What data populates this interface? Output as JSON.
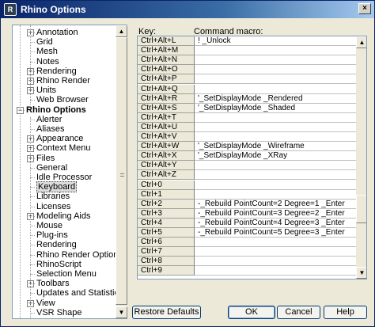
{
  "window": {
    "title": "Rhino Options"
  },
  "tree": {
    "items": [
      {
        "label": "Annotation",
        "level": 2,
        "expander": "+"
      },
      {
        "label": "Grid",
        "level": 2
      },
      {
        "label": "Mesh",
        "level": 2
      },
      {
        "label": "Notes",
        "level": 2
      },
      {
        "label": "Rendering",
        "level": 2,
        "expander": "+"
      },
      {
        "label": "Rhino Render",
        "level": 2,
        "expander": "+"
      },
      {
        "label": "Units",
        "level": 2,
        "expander": "+"
      },
      {
        "label": "Web Browser",
        "level": 2
      },
      {
        "label": "Rhino Options",
        "level": 1,
        "expander": "−",
        "bold": true
      },
      {
        "label": "Alerter",
        "level": 2
      },
      {
        "label": "Aliases",
        "level": 2
      },
      {
        "label": "Appearance",
        "level": 2,
        "expander": "+"
      },
      {
        "label": "Context Menu",
        "level": 2,
        "expander": "+"
      },
      {
        "label": "Files",
        "level": 2,
        "expander": "+"
      },
      {
        "label": "General",
        "level": 2
      },
      {
        "label": "Idle Processor",
        "level": 2
      },
      {
        "label": "Keyboard",
        "level": 2,
        "selected": true
      },
      {
        "label": "Libraries",
        "level": 2
      },
      {
        "label": "Licenses",
        "level": 2
      },
      {
        "label": "Modeling Aids",
        "level": 2,
        "expander": "+"
      },
      {
        "label": "Mouse",
        "level": 2
      },
      {
        "label": "Plug-ins",
        "level": 2
      },
      {
        "label": "Rendering",
        "level": 2
      },
      {
        "label": "Rhino Render Options",
        "level": 2
      },
      {
        "label": "RhinoScript",
        "level": 2
      },
      {
        "label": "Selection Menu",
        "level": 2
      },
      {
        "label": "Toolbars",
        "level": 2,
        "expander": "+"
      },
      {
        "label": "Updates and Statistics",
        "level": 2
      },
      {
        "label": "View",
        "level": 2,
        "expander": "+"
      },
      {
        "label": "VSR Shape",
        "level": 2
      }
    ]
  },
  "keyboard": {
    "key_header": "Key:",
    "macro_header": "Command macro:",
    "rows": [
      {
        "key": "Ctrl+Alt+L",
        "macro": "! _Unlock"
      },
      {
        "key": "Ctrl+Alt+M",
        "macro": ""
      },
      {
        "key": "Ctrl+Alt+N",
        "macro": ""
      },
      {
        "key": "Ctrl+Alt+O",
        "macro": ""
      },
      {
        "key": "Ctrl+Alt+P",
        "macro": ""
      },
      {
        "key": "Ctrl+Alt+Q",
        "macro": ""
      },
      {
        "key": "Ctrl+Alt+R",
        "macro": "'_SetDisplayMode _Rendered"
      },
      {
        "key": "Ctrl+Alt+S",
        "macro": "'_SetDisplayMode _Shaded"
      },
      {
        "key": "Ctrl+Alt+T",
        "macro": ""
      },
      {
        "key": "Ctrl+Alt+U",
        "macro": ""
      },
      {
        "key": "Ctrl+Alt+V",
        "macro": ""
      },
      {
        "key": "Ctrl+Alt+W",
        "macro": "'_SetDisplayMode _Wireframe"
      },
      {
        "key": "Ctrl+Alt+X",
        "macro": "'_SetDisplayMode _XRay"
      },
      {
        "key": "Ctrl+Alt+Y",
        "macro": ""
      },
      {
        "key": "Ctrl+Alt+Z",
        "macro": ""
      },
      {
        "key": "Ctrl+0",
        "macro": ""
      },
      {
        "key": "Ctrl+1",
        "macro": ""
      },
      {
        "key": "Ctrl+2",
        "macro": "-_Rebuild PointCount=2 Degree=1 _Enter"
      },
      {
        "key": "Ctrl+3",
        "macro": "-_Rebuild PointCount=3 Degree=2 _Enter"
      },
      {
        "key": "Ctrl+4",
        "macro": "-_Rebuild PointCount=4 Degree=3 _Enter"
      },
      {
        "key": "Ctrl+5",
        "macro": "-_Rebuild PointCount=5 Degree=3 _Enter"
      },
      {
        "key": "Ctrl+6",
        "macro": ""
      },
      {
        "key": "Ctrl+7",
        "macro": ""
      },
      {
        "key": "Ctrl+8",
        "macro": ""
      },
      {
        "key": "Ctrl+9",
        "macro": ""
      }
    ]
  },
  "buttons": {
    "restore_defaults": "Restore Defaults",
    "ok": "OK",
    "cancel": "Cancel",
    "help": "Help",
    "close": "×"
  },
  "icons": {
    "scroll_up": "▲",
    "scroll_down": "▼",
    "app_icon": "R"
  }
}
